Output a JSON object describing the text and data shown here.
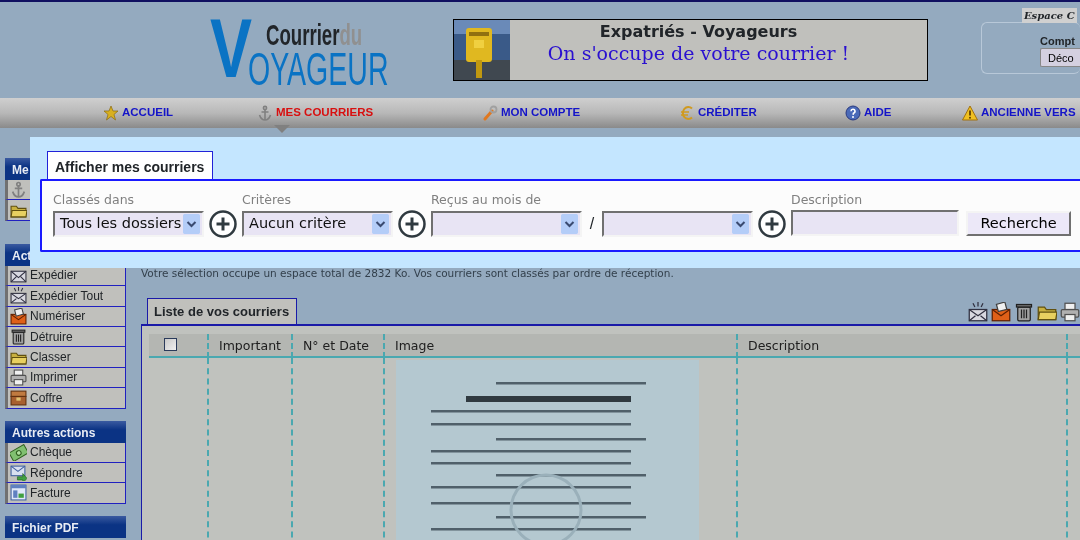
{
  "header": {
    "logo": {
      "initial": "V",
      "top": "Courrier",
      "top_suffix": "du",
      "bottom": "OYAGEUR"
    },
    "banner": {
      "title": "Expatriés - Voyageurs",
      "slogan": "On s'occupe de votre courrier !"
    },
    "account": {
      "title": "Espace C",
      "label": "Compt",
      "button": "Déco"
    }
  },
  "nav": [
    {
      "label": "ACCUEIL",
      "kind": "star",
      "selected": false
    },
    {
      "label": "MES COURRIERS",
      "kind": "anchor",
      "selected": true
    },
    {
      "label": "MON COMPTE",
      "kind": "wrench",
      "selected": false
    },
    {
      "label": "CRÉDITER",
      "kind": "euro",
      "selected": false
    },
    {
      "label": "AIDE",
      "kind": "help",
      "selected": false
    },
    {
      "label": "ANCIENNE VERS",
      "kind": "warning",
      "selected": false
    }
  ],
  "sidebar": [
    {
      "title": "Me",
      "items": [
        {
          "kind": "anchor"
        },
        {
          "kind": "folder"
        }
      ]
    },
    {
      "title": "Act",
      "items": [
        {
          "label": "Expédier",
          "kind": "envelope"
        },
        {
          "label": "Expédier Tout",
          "kind": "burst"
        },
        {
          "label": "Numériser",
          "kind": "scan"
        },
        {
          "label": "Détruire",
          "kind": "trash"
        },
        {
          "label": "Classer",
          "kind": "folder"
        },
        {
          "label": "Imprimer",
          "kind": "printer"
        },
        {
          "label": "Coffre",
          "kind": "chest"
        }
      ]
    },
    {
      "title": "Autres actions",
      "items": [
        {
          "label": "Chèque",
          "kind": "money"
        },
        {
          "label": "Répondre",
          "kind": "reply"
        },
        {
          "label": "Facture",
          "kind": "invoice"
        }
      ]
    },
    {
      "title": "Fichier PDF"
    }
  ],
  "dialog": {
    "tab": "Afficher mes courriers",
    "groups": [
      {
        "label": "Classés dans",
        "controls": [
          {
            "kind": "select",
            "value": "Tous les dossiers"
          },
          {
            "kind": "add"
          }
        ]
      },
      {
        "label": "Critères",
        "controls": [
          {
            "kind": "select",
            "value": "Aucun critère"
          },
          {
            "kind": "add"
          }
        ]
      },
      {
        "label": "Reçus au mois de",
        "controls": [
          {
            "kind": "select"
          },
          {
            "kind": "separator",
            "text": "/"
          },
          {
            "kind": "select"
          },
          {
            "kind": "add"
          }
        ]
      },
      {
        "label": "Description",
        "controls": [
          {
            "kind": "input"
          },
          {
            "kind": "button",
            "text": "Recherche"
          }
        ]
      }
    ]
  },
  "info": "Votre sélection occupe un espace total de 2832 Ko. Vos courriers sont classés par ordre de réception.",
  "list": {
    "tab": "Liste de vos courriers",
    "toolbar": [
      {
        "kind": "burst"
      },
      {
        "kind": "scan"
      },
      {
        "kind": "trash"
      },
      {
        "kind": "folder"
      },
      {
        "kind": "printer"
      }
    ],
    "select_all": {
      "checked": false
    },
    "columns": [
      "Important",
      "N° et Date",
      "Image",
      "Description"
    ],
    "rows": [
      {
        "kind": "picture"
      }
    ]
  }
}
